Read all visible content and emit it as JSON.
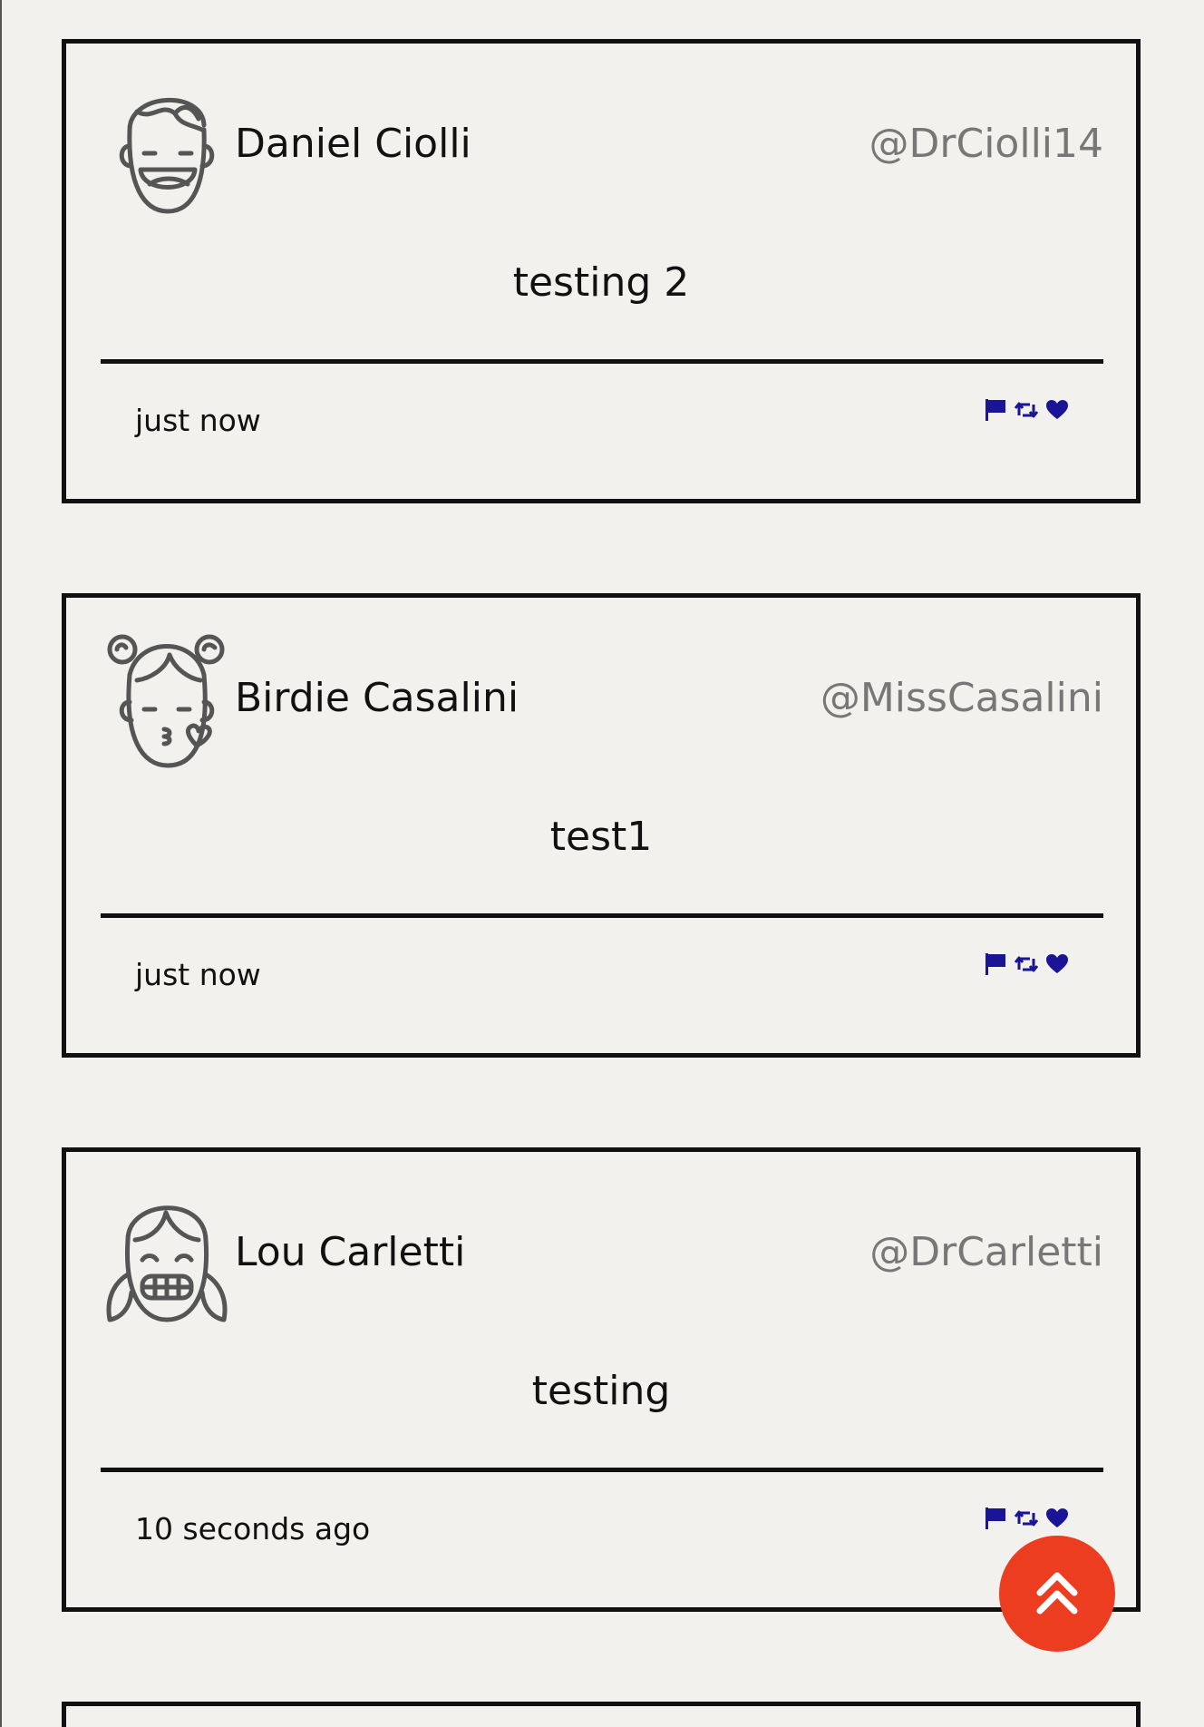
{
  "tweets": [
    {
      "name": "Daniel Ciolli",
      "handle": "@DrCiolli14",
      "text": "testing 2",
      "time": "just now",
      "avatar_icon": "laughing-boy-avatar-icon"
    },
    {
      "name": "Birdie Casalini",
      "handle": "@MissCasalini",
      "text": "test1",
      "time": "just now",
      "avatar_icon": "kissing-girl-avatar-icon"
    },
    {
      "name": "Lou Carletti",
      "handle": "@DrCarletti",
      "text": "testing",
      "time": "10 seconds ago",
      "avatar_icon": "grinning-girl-avatar-icon"
    }
  ],
  "actions": [
    "flag-icon",
    "retweet-icon",
    "heart-icon"
  ],
  "scroll_top_icon": "double-chevron-up-icon",
  "colors": {
    "background": "#f3f1ed",
    "border": "#111111",
    "handle": "#777777",
    "action_icons": "#1a1496",
    "fab": "#ec3d20"
  }
}
